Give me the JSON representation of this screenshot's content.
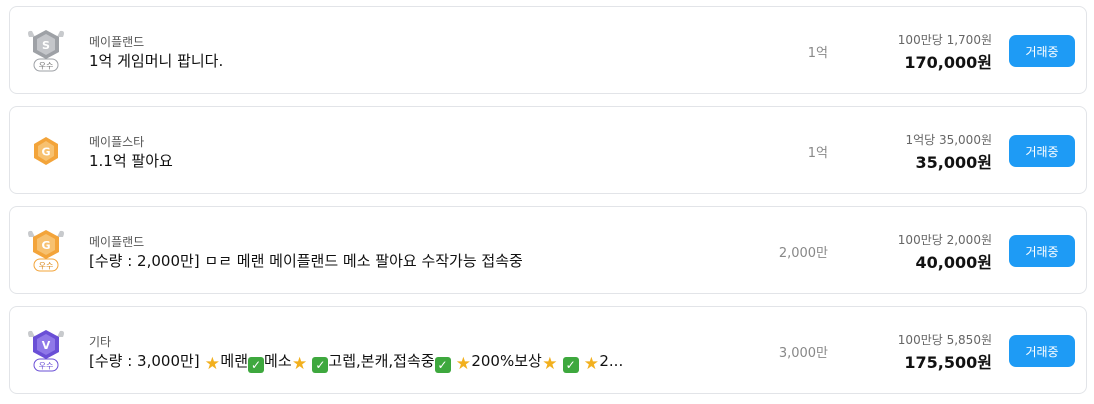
{
  "listings": [
    {
      "category": "메이플랜드",
      "title": "1억 게임머니 팝니다.",
      "quantity": "1억",
      "unit_price": "100만당 1,700원",
      "price": "170,000원",
      "button_label": "거래중",
      "badge": {
        "letter": "S",
        "label": "우수",
        "color": "#a7a9ad"
      }
    },
    {
      "category": "메이플스타",
      "title": "1.1억 팔아요",
      "quantity": "1억",
      "unit_price": "1억당 35,000원",
      "price": "35,000원",
      "button_label": "거래중",
      "badge": {
        "letter": "G",
        "label": "",
        "color": "#f3a43a"
      }
    },
    {
      "category": "메이플랜드",
      "title": "[수량 : 2,000만] ㅁㄹ 메랜 메이플랜드 메소 팔아요 수작가능 접속중",
      "quantity": "2,000만",
      "unit_price": "100만당 2,000원",
      "price": "40,000원",
      "button_label": "거래중",
      "badge": {
        "letter": "G",
        "label": "우수",
        "color": "#f3a43a"
      }
    },
    {
      "category": "기타",
      "title_parts": [
        "[수량 : 3,000만] ",
        "메랜",
        "메소",
        "고렙,본캐,접속중",
        "200%보상",
        "2..."
      ],
      "quantity": "3,000만",
      "unit_price": "100만당 5,850원",
      "price": "175,500원",
      "button_label": "거래중",
      "badge": {
        "letter": "V",
        "label": "우수",
        "color": "#6a4fd6"
      }
    }
  ],
  "icons": {
    "star": "star-emoji-icon",
    "check": "check-mark-emoji-icon"
  }
}
